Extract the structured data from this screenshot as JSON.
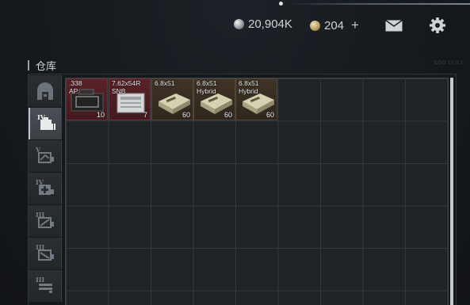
{
  "currency": {
    "roubles": "20,904K",
    "gp_coins": "204",
    "add": "+"
  },
  "panel": {
    "title": "仓库",
    "faint_label": "EOD 17.0.1"
  },
  "sidebar": {
    "tabs": [
      {
        "id": "base",
        "level": ""
      },
      {
        "id": "stash-iv",
        "level": "IV"
      },
      {
        "id": "stash-v",
        "level": "V"
      },
      {
        "id": "stash-iv-b",
        "level": "IV"
      },
      {
        "id": "stash-iii",
        "level": "III"
      },
      {
        "id": "stash-iii-b",
        "level": "III"
      },
      {
        "id": "stash-iii-c",
        "level": "III"
      }
    ]
  },
  "items": [
    {
      "name": ".338\nAP",
      "count": "10",
      "color": "red"
    },
    {
      "name": "7.62x54R\nSNB",
      "count": "7",
      "color": "red"
    },
    {
      "name": "6.8x51",
      "count": "60",
      "color": "brown"
    },
    {
      "name": "6.8x51\nHybrid",
      "count": "60",
      "color": "brown"
    },
    {
      "name": "6.8x51\nHybrid",
      "count": "60",
      "color": "brown"
    }
  ],
  "colors": {
    "accent_red": "#5a2228",
    "accent_brown": "#3e3326",
    "grid_line": "#34393e",
    "scrollbar": "#c4c8cb"
  }
}
